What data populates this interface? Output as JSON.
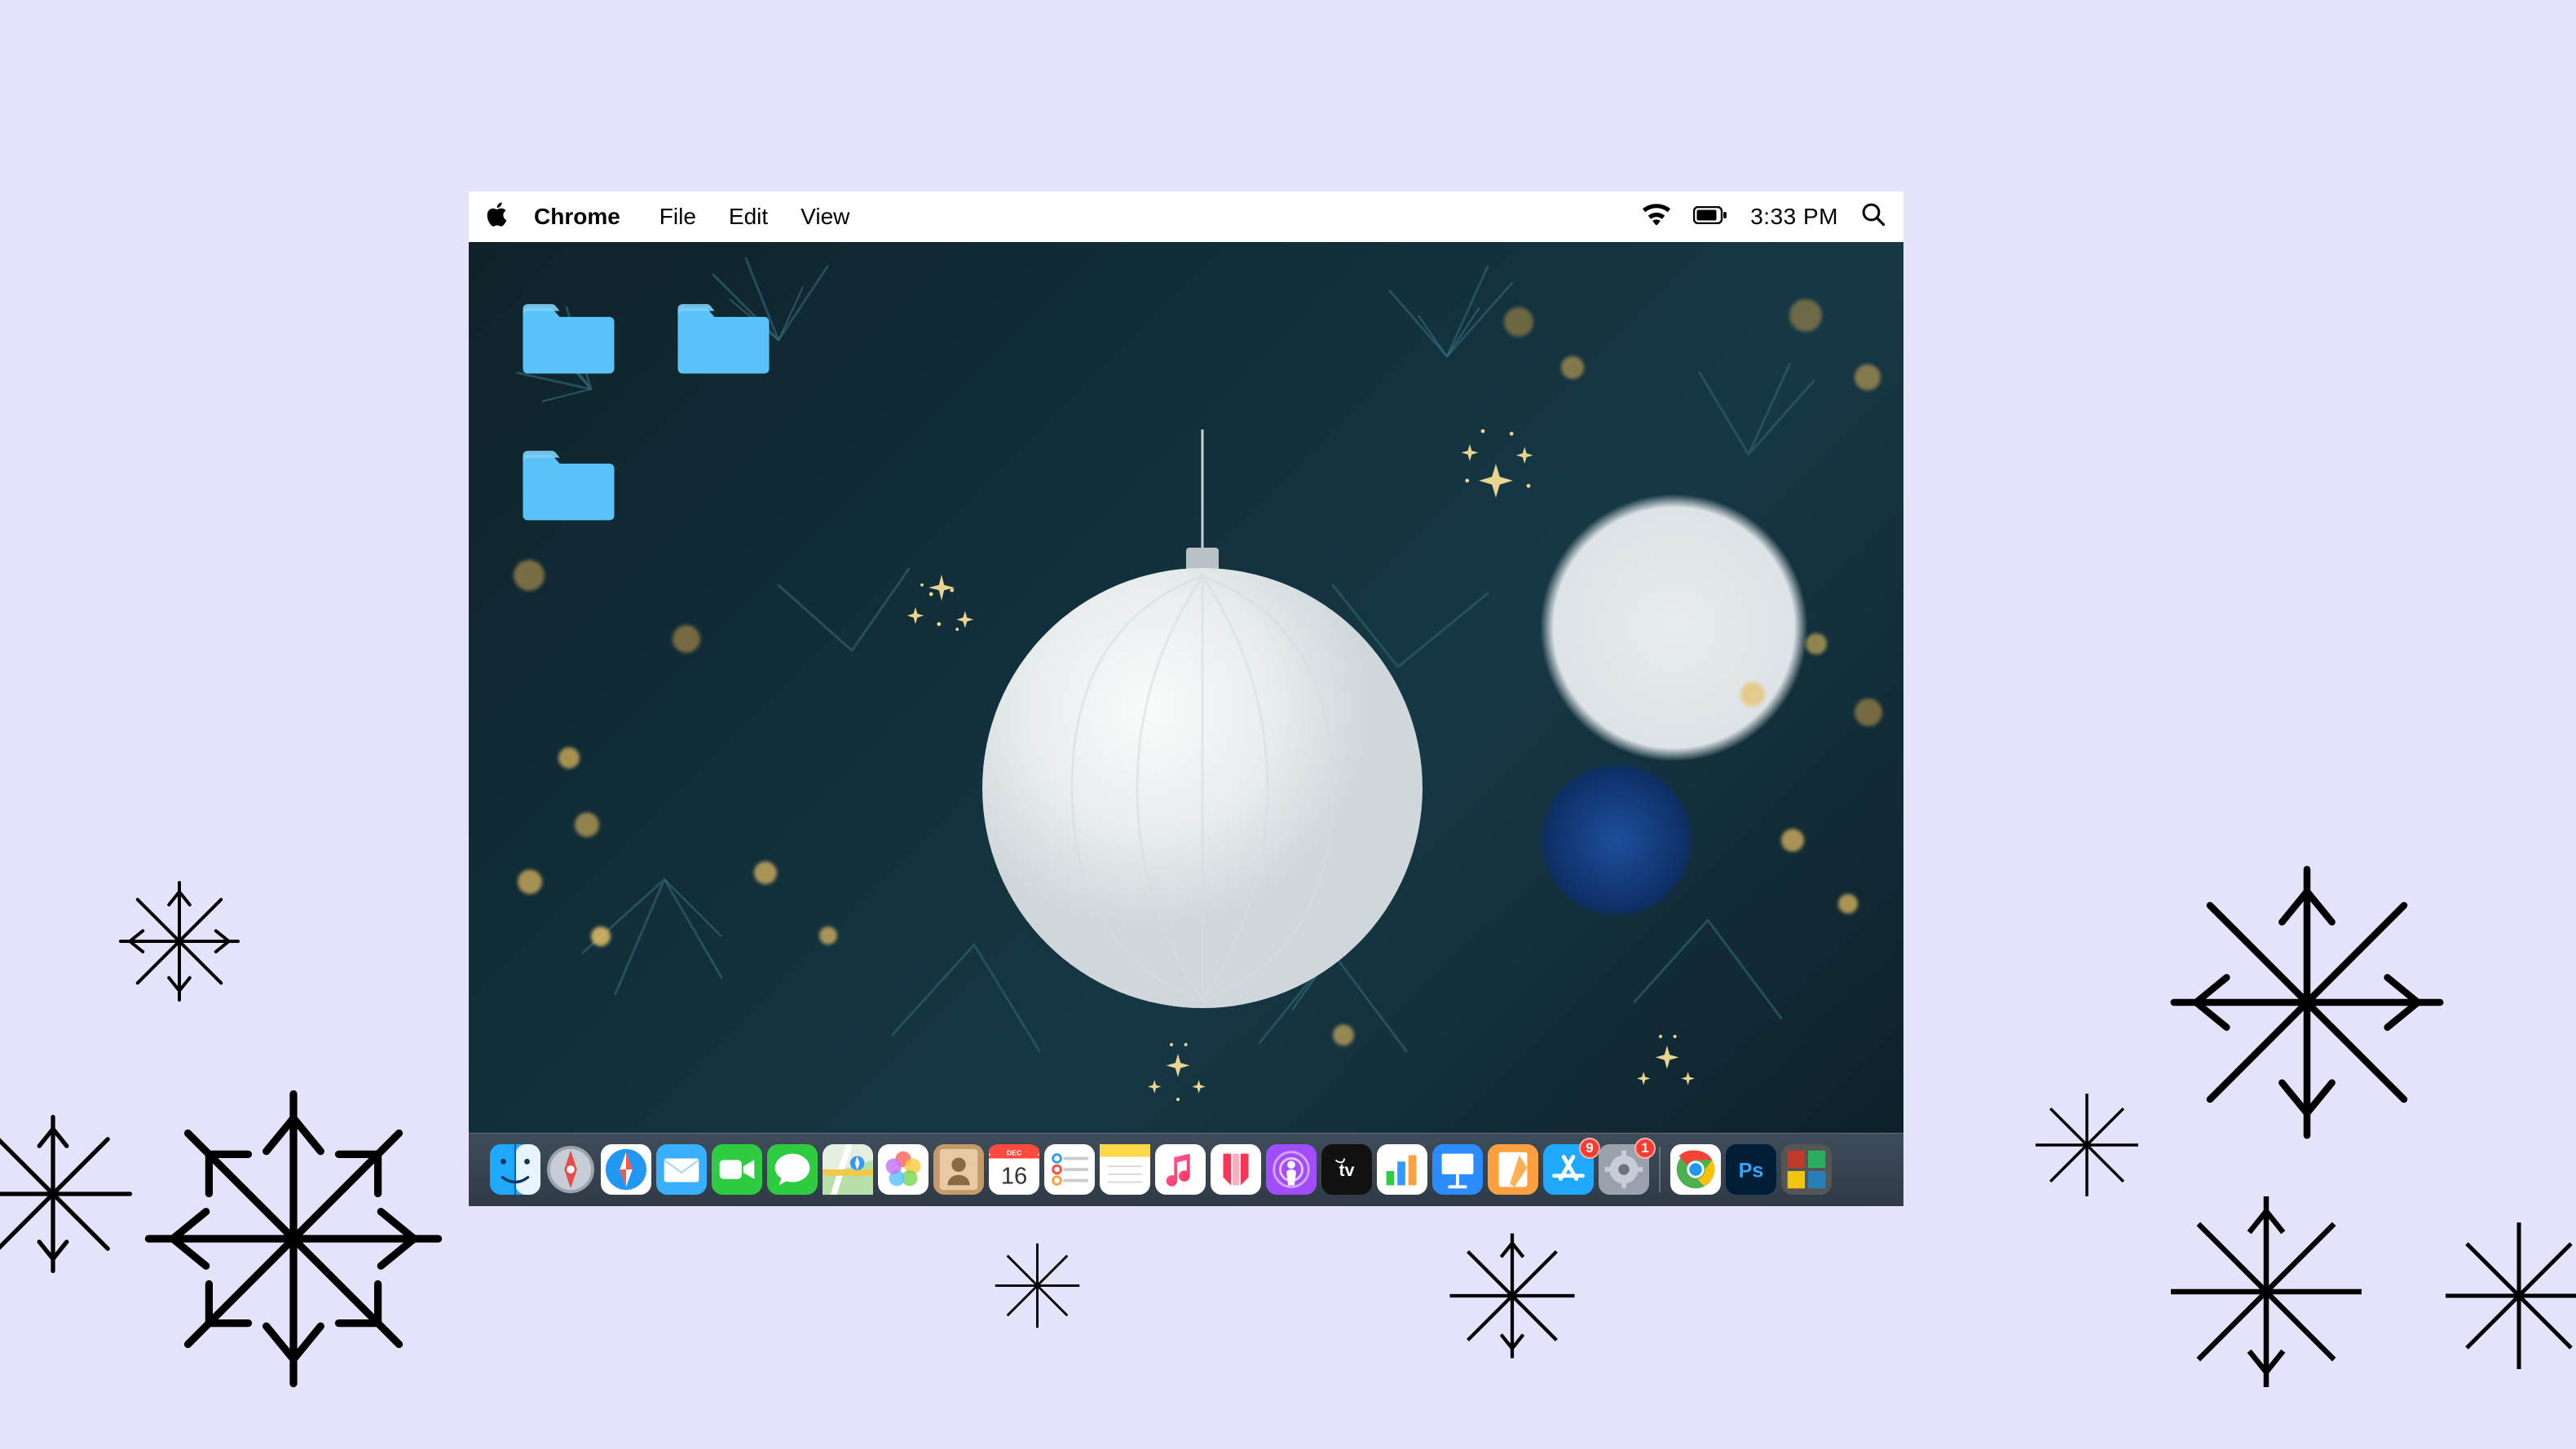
{
  "menubar": {
    "app_name": "Chrome",
    "items": [
      "File",
      "Edit",
      "View"
    ],
    "clock": "3:33 PM"
  },
  "desktop_folders": [
    "folder-1",
    "folder-2",
    "folder-3"
  ],
  "dock": [
    {
      "name": "finder",
      "badge": null
    },
    {
      "name": "launchpad",
      "badge": null
    },
    {
      "name": "safari",
      "badge": null
    },
    {
      "name": "mail",
      "badge": null
    },
    {
      "name": "facetime",
      "badge": null
    },
    {
      "name": "messages",
      "badge": null
    },
    {
      "name": "maps",
      "badge": null
    },
    {
      "name": "photos",
      "badge": null
    },
    {
      "name": "contacts",
      "badge": null
    },
    {
      "name": "calendar",
      "badge": null,
      "day": "16",
      "month": "DEC"
    },
    {
      "name": "reminders",
      "badge": null
    },
    {
      "name": "notes",
      "badge": null
    },
    {
      "name": "music",
      "badge": null
    },
    {
      "name": "news",
      "badge": null
    },
    {
      "name": "podcasts",
      "badge": null
    },
    {
      "name": "tv",
      "badge": null
    },
    {
      "name": "numbers",
      "badge": null
    },
    {
      "name": "keynote",
      "badge": null
    },
    {
      "name": "pages",
      "badge": null
    },
    {
      "name": "appstore",
      "badge": "9"
    },
    {
      "name": "settings",
      "badge": "1"
    },
    {
      "name": "chrome",
      "badge": null
    },
    {
      "name": "photoshop",
      "badge": null
    },
    {
      "name": "game",
      "badge": null
    }
  ]
}
